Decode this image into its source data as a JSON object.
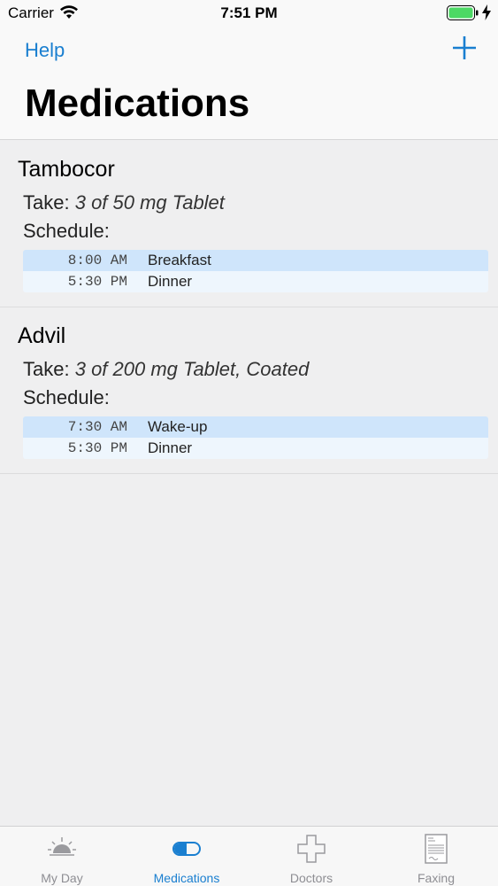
{
  "status": {
    "carrier": "Carrier",
    "time": "7:51 PM"
  },
  "nav": {
    "help_label": "Help",
    "title": "Medications"
  },
  "medications": [
    {
      "name": "Tambocor",
      "take_label": "Take:",
      "dose": "3 of 50 mg Tablet",
      "schedule_label": "Schedule:",
      "schedule": [
        {
          "time": "8:00 AM",
          "meal": "Breakfast"
        },
        {
          "time": "5:30 PM",
          "meal": "Dinner"
        }
      ]
    },
    {
      "name": "Advil",
      "take_label": "Take:",
      "dose": "3 of 200 mg Tablet, Coated",
      "schedule_label": "Schedule:",
      "schedule": [
        {
          "time": "7:30 AM",
          "meal": "Wake-up"
        },
        {
          "time": "5:30 PM",
          "meal": "Dinner"
        }
      ]
    }
  ],
  "tabs": [
    {
      "label": "My Day",
      "icon": "sunrise-icon",
      "active": false
    },
    {
      "label": "Medications",
      "icon": "pill-icon",
      "active": true
    },
    {
      "label": "Doctors",
      "icon": "medical-cross-icon",
      "active": false
    },
    {
      "label": "Faxing",
      "icon": "fax-document-icon",
      "active": false
    }
  ],
  "colors": {
    "accent": "#1a7fd0",
    "row_highlight": "#cfe5fb",
    "row_alt": "#eef6fd",
    "battery": "#4cd964"
  }
}
